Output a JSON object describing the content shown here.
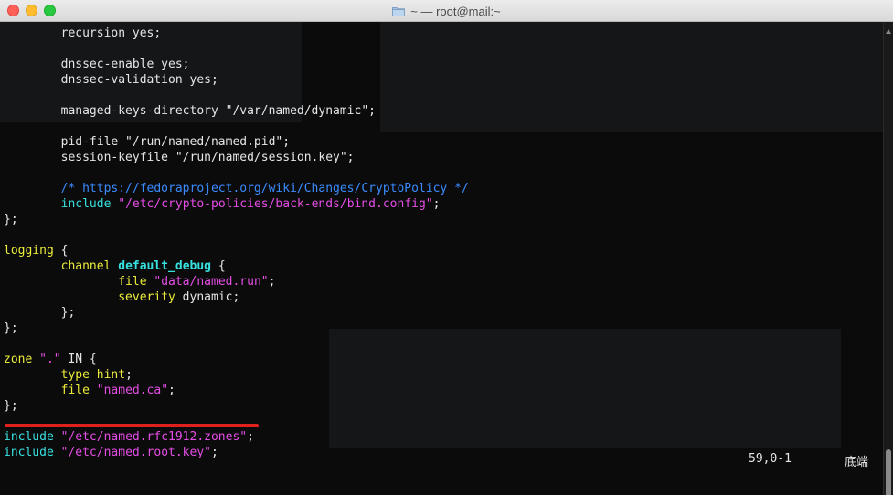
{
  "window": {
    "title": "~ — root@mail:~"
  },
  "colors": {
    "keyword": "#ecec3c",
    "string": "#e54ee5",
    "identifier": "#38e0e0",
    "comment": "#3a8cff",
    "text": "#e6e6e6",
    "highlight_underline": "#e0201c"
  },
  "editor": {
    "lines": [
      {
        "segments": [
          {
            "text": "        recursion yes;",
            "style": "plain"
          }
        ]
      },
      {
        "segments": [
          {
            "text": "",
            "style": "plain"
          }
        ]
      },
      {
        "segments": [
          {
            "text": "        dnssec-enable yes;",
            "style": "plain"
          }
        ]
      },
      {
        "segments": [
          {
            "text": "        dnssec-validation yes;",
            "style": "plain"
          }
        ]
      },
      {
        "segments": [
          {
            "text": "",
            "style": "plain"
          }
        ]
      },
      {
        "segments": [
          {
            "text": "        managed-keys-directory \"/var/named/dynamic\";",
            "style": "plain"
          }
        ]
      },
      {
        "segments": [
          {
            "text": "",
            "style": "plain"
          }
        ]
      },
      {
        "segments": [
          {
            "text": "        pid-file \"/run/named/named.pid\";",
            "style": "plain"
          }
        ]
      },
      {
        "segments": [
          {
            "text": "        session-keyfile \"/run/named/session.key\";",
            "style": "plain"
          }
        ]
      },
      {
        "segments": [
          {
            "text": "",
            "style": "plain"
          }
        ]
      },
      {
        "segments": [
          {
            "text": "        /* https://fedoraproject.org/wiki/Changes/CryptoPolicy */",
            "style": "comment"
          }
        ]
      },
      {
        "segments": [
          {
            "text": "        ",
            "style": "plain"
          },
          {
            "text": "include",
            "style": "cyan"
          },
          {
            "text": " ",
            "style": "plain"
          },
          {
            "text": "\"/etc/crypto-policies/back-ends/bind.config\"",
            "style": "string"
          },
          {
            "text": ";",
            "style": "plain"
          }
        ]
      },
      {
        "segments": [
          {
            "text": "};",
            "style": "plain"
          }
        ]
      },
      {
        "segments": [
          {
            "text": "",
            "style": "plain"
          }
        ]
      },
      {
        "segments": [
          {
            "text": "logging",
            "style": "keyword"
          },
          {
            "text": " {",
            "style": "plain"
          }
        ]
      },
      {
        "segments": [
          {
            "text": "        ",
            "style": "plain"
          },
          {
            "text": "channel",
            "style": "keyword"
          },
          {
            "text": " ",
            "style": "plain"
          },
          {
            "text": "default_debug",
            "style": "cyan-bold"
          },
          {
            "text": " {",
            "style": "plain"
          }
        ]
      },
      {
        "segments": [
          {
            "text": "                ",
            "style": "plain"
          },
          {
            "text": "file",
            "style": "keyword"
          },
          {
            "text": " ",
            "style": "plain"
          },
          {
            "text": "\"data/named.run\"",
            "style": "string"
          },
          {
            "text": ";",
            "style": "plain"
          }
        ]
      },
      {
        "segments": [
          {
            "text": "                ",
            "style": "plain"
          },
          {
            "text": "severity",
            "style": "keyword"
          },
          {
            "text": " dynamic;",
            "style": "plain"
          }
        ]
      },
      {
        "segments": [
          {
            "text": "        };",
            "style": "plain"
          }
        ]
      },
      {
        "segments": [
          {
            "text": "};",
            "style": "plain"
          }
        ]
      },
      {
        "segments": [
          {
            "text": "",
            "style": "plain"
          }
        ]
      },
      {
        "segments": [
          {
            "text": "zone",
            "style": "keyword"
          },
          {
            "text": " ",
            "style": "plain"
          },
          {
            "text": "\".\"",
            "style": "string"
          },
          {
            "text": " IN {",
            "style": "plain"
          }
        ]
      },
      {
        "segments": [
          {
            "text": "        ",
            "style": "plain"
          },
          {
            "text": "type",
            "style": "keyword"
          },
          {
            "text": " ",
            "style": "plain"
          },
          {
            "text": "hint",
            "style": "keyword"
          },
          {
            "text": ";",
            "style": "plain"
          }
        ]
      },
      {
        "segments": [
          {
            "text": "        ",
            "style": "plain"
          },
          {
            "text": "file",
            "style": "keyword"
          },
          {
            "text": " ",
            "style": "plain"
          },
          {
            "text": "\"named.ca\"",
            "style": "string"
          },
          {
            "text": ";",
            "style": "plain"
          }
        ]
      },
      {
        "segments": [
          {
            "text": "};",
            "style": "plain"
          }
        ]
      },
      {
        "segments": [
          {
            "text": "",
            "style": "plain"
          }
        ]
      },
      {
        "segments": [
          {
            "text": "include",
            "style": "cyan"
          },
          {
            "text": " ",
            "style": "plain"
          },
          {
            "text": "\"/etc/named.rfc1912.zones\"",
            "style": "string"
          },
          {
            "text": ";",
            "style": "plain"
          }
        ]
      },
      {
        "segments": [
          {
            "text": "include",
            "style": "cyan"
          },
          {
            "text": " ",
            "style": "plain"
          },
          {
            "text": "\"/etc/named.root.key\"",
            "style": "string"
          },
          {
            "text": ";",
            "style": "plain"
          }
        ]
      }
    ]
  },
  "statusbar": {
    "position": "59,0-1",
    "scroll_indicator": "底端"
  }
}
